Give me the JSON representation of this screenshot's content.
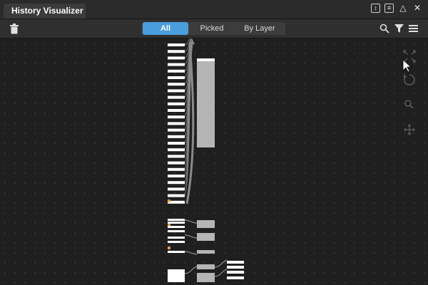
{
  "window": {
    "tab_title": "History Visualizer",
    "controls": [
      "pin-icon",
      "menu-icon",
      "maximize-icon",
      "close-icon"
    ]
  },
  "toolbar": {
    "filter_tabs": [
      {
        "label": "All",
        "active": true
      },
      {
        "label": "Picked",
        "active": false
      },
      {
        "label": "By Layer",
        "active": false
      }
    ],
    "right_icons": [
      "search-icon",
      "filter-icon",
      "menu-icon"
    ],
    "left_icons": [
      "trash-icon"
    ]
  },
  "canvas": {
    "side_tools": [
      "frame-all-icon",
      "cursor-icon",
      "reset-icon",
      "zoom-icon",
      "pan-icon"
    ]
  },
  "colors": {
    "accent": "#4a9edb",
    "node_white": "#ffffff",
    "node_gray": "#b5b5b5",
    "connector": "#8a8a8a",
    "highlight": "#f0a040",
    "background": "#1f1f1f"
  }
}
